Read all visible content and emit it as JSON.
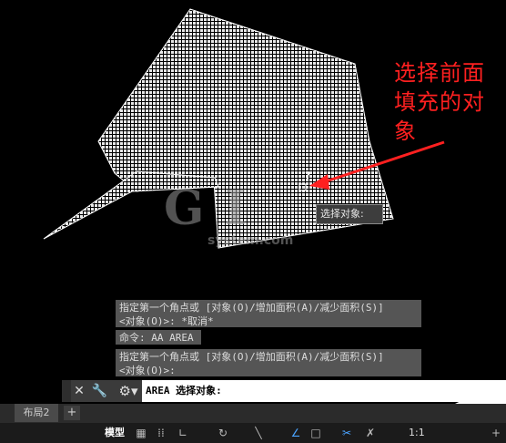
{
  "annotation": {
    "lines": [
      "选择前面",
      "填充的对",
      "象"
    ],
    "color": "#ff2020"
  },
  "watermark": {
    "logo": "G  I",
    "sub": "system.com"
  },
  "cursor": {
    "mark": "?"
  },
  "tooltip": {
    "text": "选择对象:"
  },
  "command_history": [
    {
      "line1": "指定第一个角点或 [对象(O)/增加面积(A)/减少面积(S)]",
      "line2": "<对象(O)>: *取消*"
    },
    {
      "line1": "命令: AA AREA"
    },
    {
      "line1": "指定第一个角点或 [对象(O)/增加面积(A)/减少面积(S)]",
      "line2": "<对象(O)>:"
    }
  ],
  "command_line": {
    "prompt": "AREA 选择对象:",
    "close_icon": "close-icon",
    "customize_icon": "wrench-icon",
    "recent_icon": "gear-icon"
  },
  "layout_tabs": {
    "tab_label": "布局2",
    "add_label": "+"
  },
  "status_bar": {
    "model_label": "模型",
    "scale_label": "1:1",
    "icons": [
      "grid-icon",
      "snap-icon",
      "ortho-icon",
      "polar-icon",
      "osnap-icon",
      "isodraft-icon",
      "dynucs-icon",
      "annotation-icon",
      "workspace-icon",
      "plus-icon"
    ]
  },
  "colors": {
    "background": "#000000",
    "hatch": "#ffffff",
    "arrow": "#ff2020",
    "panel": "#555555"
  }
}
